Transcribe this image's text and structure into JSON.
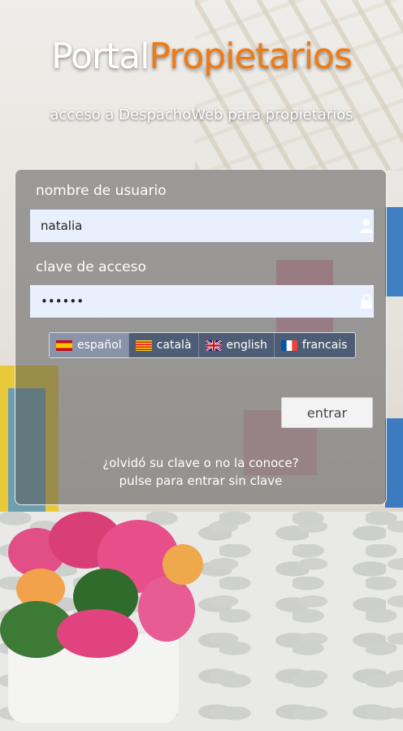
{
  "header": {
    "logo_part1": "Portal",
    "logo_part2": "Propietarios",
    "subtitle": "acceso a DespachoWeb para propietarios"
  },
  "login": {
    "username_label": "nombre de usuario",
    "username_value": "natalia",
    "password_label": "clave de acceso",
    "password_value": "••••••",
    "submit_label": "entrar",
    "forgot_line1": "¿olvidó su clave o no la conoce?",
    "forgot_line2": "pulse para entrar sin clave"
  },
  "languages": [
    {
      "label": "español",
      "flag": "es-flag-icon",
      "active": true
    },
    {
      "label": "català",
      "flag": "ca-flag-icon",
      "active": false
    },
    {
      "label": "english",
      "flag": "uk-flag-icon",
      "active": false
    },
    {
      "label": "francais",
      "flag": "fr-flag-icon",
      "active": false
    }
  ],
  "colors": {
    "brand_orange": "#f07a12",
    "panel_bg": "rgba(90,90,90,.55)",
    "lang_bar_bg": "#4e5d75"
  }
}
